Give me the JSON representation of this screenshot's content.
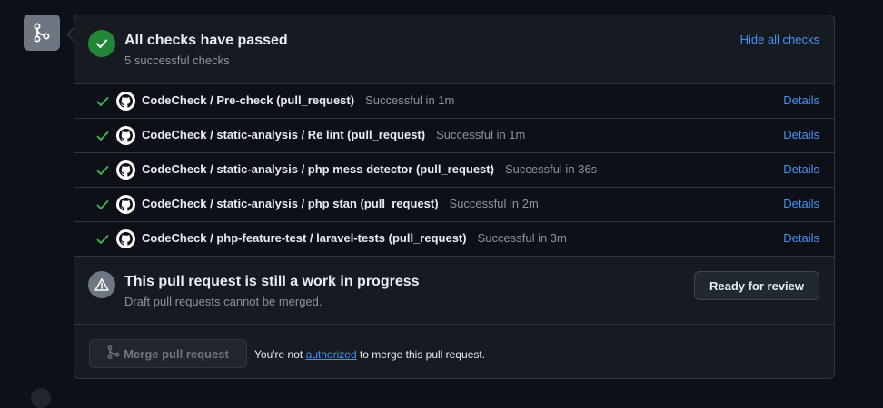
{
  "summary": {
    "title": "All checks have passed",
    "subtitle": "5 successful checks",
    "hide_link": "Hide all checks"
  },
  "checks": [
    {
      "name": "CodeCheck / Pre-check (pull_request)",
      "status": "Successful in 1m",
      "details": "Details"
    },
    {
      "name": "CodeCheck / static-analysis / Re lint (pull_request)",
      "status": "Successful in 1m",
      "details": "Details"
    },
    {
      "name": "CodeCheck / static-analysis / php mess detector (pull_request)",
      "status": "Successful in 36s",
      "details": "Details"
    },
    {
      "name": "CodeCheck / static-analysis / php stan (pull_request)",
      "status": "Successful in 2m",
      "details": "Details"
    },
    {
      "name": "CodeCheck / php-feature-test / laravel-tests (pull_request)",
      "status": "Successful in 3m",
      "details": "Details"
    }
  ],
  "wip": {
    "title": "This pull request is still a work in progress",
    "subtitle": "Draft pull requests cannot be merged.",
    "ready_button": "Ready for review"
  },
  "merge": {
    "button_label": "Merge pull request",
    "note_prefix": "You're not",
    "note_link": "authorized",
    "note_suffix": "to merge this pull request."
  },
  "colors": {
    "background": "#0d1117",
    "panel": "#161b22",
    "success": "#238636",
    "check_green": "#3fb950",
    "link": "#4493f8",
    "muted": "#8b949e"
  },
  "icons": {
    "side": "git-merge-icon",
    "summary": "check-circle-icon",
    "row_status": "check-icon",
    "row_app": "github-logo-icon",
    "wip": "alert-triangle-icon",
    "merge_button": "git-merge-icon"
  }
}
